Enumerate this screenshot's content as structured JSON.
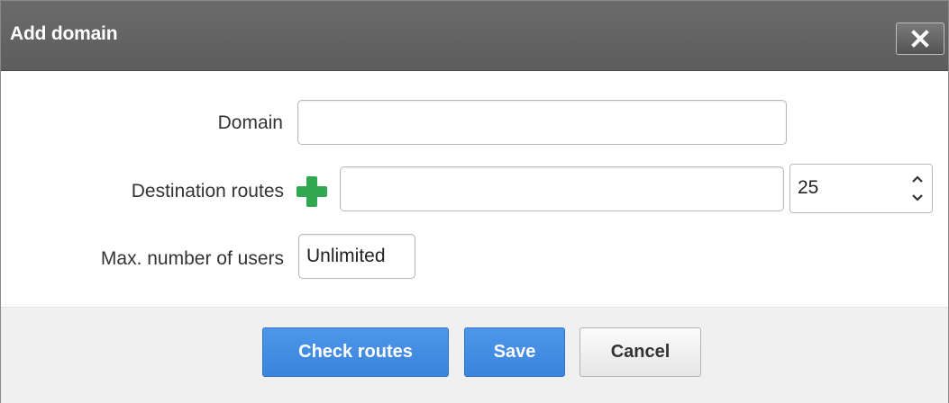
{
  "dialog": {
    "title": "Add domain",
    "close_icon": "close-icon"
  },
  "form": {
    "domain_label": "Domain",
    "domain_value": "",
    "routes_label": "Destination routes",
    "add_route_icon": "plus-icon",
    "routes_value": "",
    "port_value": "25",
    "max_users_label": "Max. number of users",
    "max_users_value": "Unlimited"
  },
  "footer": {
    "check_routes_label": "Check routes",
    "save_label": "Save",
    "cancel_label": "Cancel"
  },
  "colors": {
    "titlebar": "#5f5f5f",
    "primary_button": "#3f8ae0",
    "add_icon": "#2fa84f",
    "footer_bg": "#f0f0f0"
  }
}
